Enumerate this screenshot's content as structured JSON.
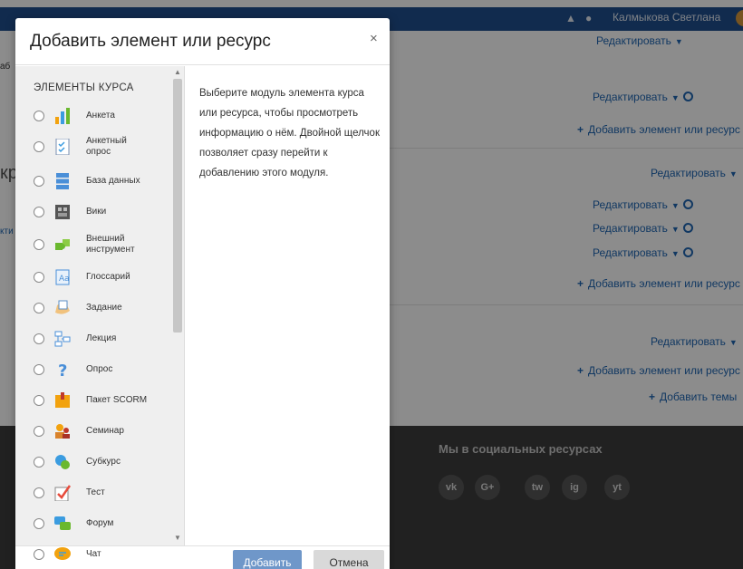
{
  "background": {
    "user_name": "Калмыкова Светлана",
    "edit_label": "Редактировать",
    "add_activity_label": "Добавить элемент или ресурс",
    "add_topics_label": "Добавить темы",
    "left_fragments": [
      "аб",
      "кр",
      "кти"
    ],
    "footer_title": "Мы в социальных ресурсах",
    "social": [
      "vk",
      "G+",
      "tw",
      "ig",
      "yt"
    ]
  },
  "modal": {
    "title": "Добавить элемент или ресурс",
    "close": "×",
    "section_label": "ЭЛЕМЕНТЫ КУРСА",
    "description": "Выберите модуль элемента курса или ресурса, чтобы просмотреть информацию о нём. Двойной щелчок позволяет сразу перейти к добавлению этого модуля.",
    "modules": [
      {
        "label": "Анкета",
        "icon": "chart-icon"
      },
      {
        "label": "Анкетный\nопрос",
        "icon": "questionnaire-icon"
      },
      {
        "label": "База данных",
        "icon": "database-icon"
      },
      {
        "label": "Вики",
        "icon": "wiki-icon"
      },
      {
        "label": "Внешний\nинструмент",
        "icon": "puzzle-icon"
      },
      {
        "label": "Глоссарий",
        "icon": "glossary-icon"
      },
      {
        "label": "Задание",
        "icon": "assignment-icon"
      },
      {
        "label": "Лекция",
        "icon": "lesson-icon"
      },
      {
        "label": "Опрос",
        "icon": "question-icon"
      },
      {
        "label": "Пакет SCORM",
        "icon": "scorm-icon"
      },
      {
        "label": "Семинар",
        "icon": "workshop-icon"
      },
      {
        "label": "Субкурс",
        "icon": "subcourse-icon"
      },
      {
        "label": "Тест",
        "icon": "quiz-icon"
      },
      {
        "label": "Форум",
        "icon": "forum-icon"
      },
      {
        "label": "Чат",
        "icon": "chat-icon"
      }
    ],
    "add_button": "Добавить",
    "cancel_button": "Отмена"
  },
  "colors": {
    "topbar": "#1f4f8f",
    "link": "#1f66b3",
    "primary_button": "#6f97c9",
    "footer": "#3c3c3c"
  }
}
